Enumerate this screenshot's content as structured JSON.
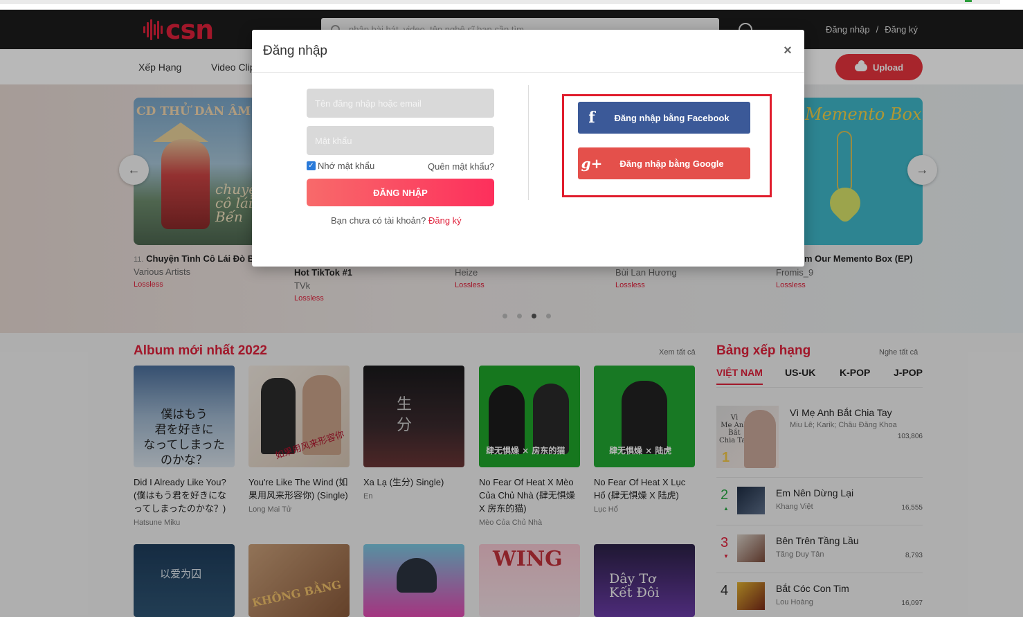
{
  "site": {
    "logo_text": "csn",
    "search_placeholder": "nhập bài hát, video, tên nghệ sĩ bạn cần tìm...",
    "login_link": "Đăng nhập",
    "separator": "/",
    "register_link": "Đăng ký",
    "nav": [
      "Xếp Hạng",
      "Video Clip"
    ],
    "upload_label": "Upload",
    "colors": {
      "brand_red": "#e0213b",
      "facebook": "#3b5998",
      "google": "#e4504b",
      "highlight": "#e01d2d"
    }
  },
  "hero": {
    "card1_cover_title": "CD THỬ DÀN ÂM THA",
    "card1_cover_script": "chuyện\ncô lái đò\nBến",
    "card5_cover_title": "Memento Box",
    "items": [
      {
        "index": "11.",
        "title": "Chuyện Tình Cô Lái Đò B",
        "artist": "Various Artists",
        "quality": "Lossless"
      },
      {
        "title": "Hot TikTok #1",
        "artist": "TVk",
        "quality": "Lossless"
      },
      {
        "title": "",
        "artist": "Heize",
        "quality": "Lossless"
      },
      {
        "title": "",
        "artist": "Bùi Lan Hương",
        "quality": "Lossless"
      },
      {
        "title": "m Our Memento Box (EP)",
        "artist": "Fromis_9",
        "quality": "Lossless"
      }
    ],
    "prev_icon": "arrow-left-icon",
    "next_icon": "arrow-right-icon"
  },
  "albums": {
    "section_title": "Album mới nhất 2022",
    "see_all": "Xem tất cả",
    "items": [
      {
        "title": "Did I Already Like You? (僕はもう君を好きになってしまったのかな？)",
        "artist": "Hatsune Miku",
        "cover_text": "僕はもう\n君を好きに\nなってしまった\nのかな？"
      },
      {
        "title": "You're Like The Wind (如果用风来形容你) (Single)",
        "artist": "Long Mai Tử",
        "cover_text": "如果用风来形容你"
      },
      {
        "title": "Xa Lạ (生分) Single)",
        "artist": "En",
        "cover_text": "生\n分"
      },
      {
        "title": "No Fear Of Heat X Mèo Của Chủ Nhà (肆无惧燥 X 房东的猫)",
        "artist": "Mèo Của Chủ Nhà",
        "cover_text": "肆无惧燥 × 房东的猫"
      },
      {
        "title": "No Fear Of Heat X Lục Hổ (肆无惧燥 X 陆虎)",
        "artist": "Lục Hổ",
        "cover_text": "肆无惧燥 × 陆虎"
      }
    ],
    "row2_cover_texts": [
      "以爱为囚",
      "KHÔNG BẰNG",
      "",
      "WING",
      "Dây Tơ Kết Đôi"
    ]
  },
  "ranking": {
    "title": "Bảng xếp hạng",
    "see_all": "Nghe tất cả",
    "tabs": [
      "VIỆT NAM",
      "US-UK",
      "K-POP",
      "J-POP"
    ],
    "top": {
      "rank": "1",
      "title": "Vì Mẹ Anh Bắt Chia Tay",
      "artists": "Miu Lê; Karik; Châu Đăng Khoa",
      "count": "103,806",
      "cover_text": "Vì\nMẹ Anh\nBắt\nChia Tay"
    },
    "rows": [
      {
        "rank": "2",
        "title": "Em Nên Dừng Lại",
        "artist": "Khang Việt",
        "count": "16,555",
        "color": "#2aa844",
        "mark": "▲"
      },
      {
        "rank": "3",
        "title": "Bên Trên Tầng Lầu",
        "artist": "Tăng Duy Tân",
        "count": "8,793",
        "color": "#e0213b",
        "mark": "▼"
      },
      {
        "rank": "4",
        "title": "Bắt Cóc Con Tim",
        "artist": "Lou Hoàng",
        "count": "16,097",
        "color": "#333",
        "mark": ""
      }
    ]
  },
  "modal": {
    "title": "Đăng nhập",
    "close_label": "×",
    "username_placeholder": "Tên đăng nhập hoặc email",
    "password_placeholder": "Mật khẩu",
    "remember_label": "Nhớ mật khẩu",
    "remember_checked": true,
    "forgot_label": "Quên mật khẩu?",
    "submit_label": "ĐĂNG NHẬP",
    "no_account_text": "Bạn chưa có tài khoản?",
    "register_link": "Đăng ký",
    "facebook_label": "Đăng nhập bằng Facebook",
    "facebook_icon_glyph": "f",
    "google_label": "Đăng nhập bằng Google",
    "google_icon_glyph": "g+"
  }
}
